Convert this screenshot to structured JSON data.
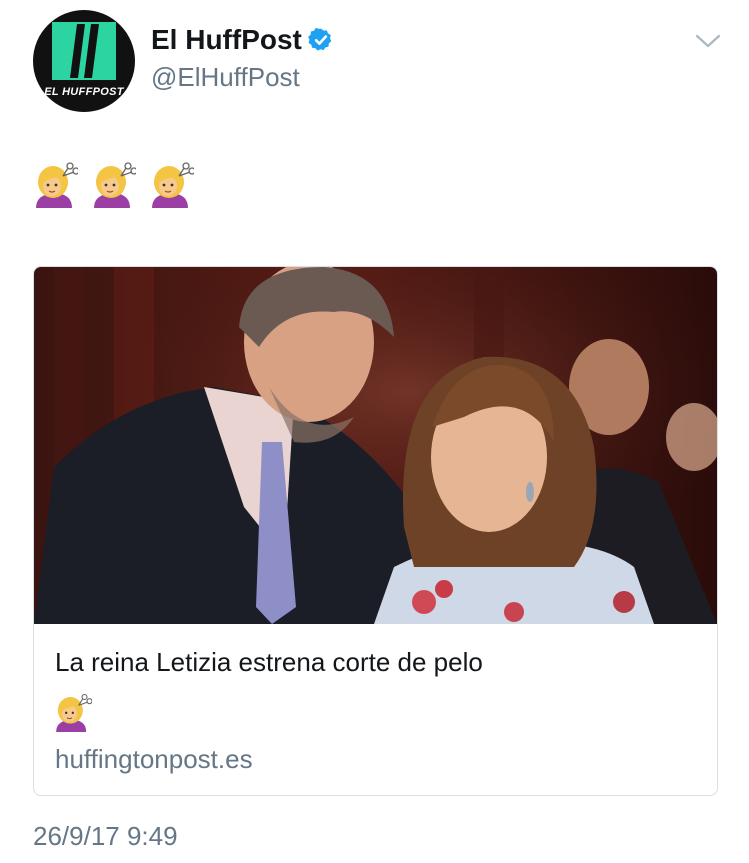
{
  "author": {
    "name": "El HuffPost",
    "handle": "@ElHuffPost",
    "avatar_text": "EL HUFFPOST",
    "verified": true
  },
  "tweet": {
    "emoji": [
      "woman-getting-haircut",
      "woman-getting-haircut",
      "woman-getting-haircut"
    ]
  },
  "card": {
    "title": "La reina Letizia estrena corte de pelo",
    "title_emoji": "woman-getting-haircut",
    "domain": "huffingtonpost.es"
  },
  "timestamp": "26/9/17 9:49",
  "colors": {
    "brand_green": "#2bd4a0",
    "verified_blue": "#1da1f2",
    "secondary_text": "#657786"
  }
}
